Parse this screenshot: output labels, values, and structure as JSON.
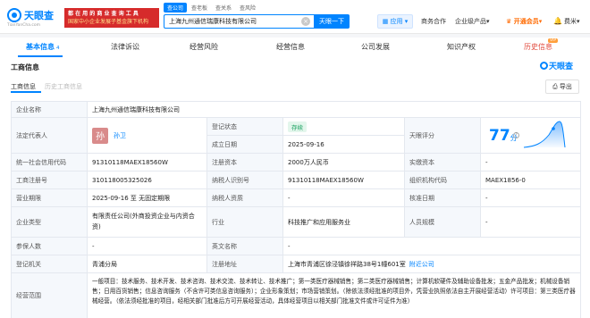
{
  "header": {
    "logo_text": "天眼查",
    "logo_sub": "TianYanCha.com",
    "promo_line1": "都 在 用 的 商 业 查 询 工 具",
    "promo_line2": "国家中小企业发展子基金旗下机构",
    "search_tabs": [
      "查公司",
      "查老板",
      "查关系",
      "查风险"
    ],
    "search_value": "上海九州通信瑞康科技有限公司",
    "search_clear": "×",
    "search_button": "天眼一下",
    "app_label": "应用",
    "nav": [
      "商务合作",
      "企业级产品"
    ],
    "vip_label": "开通会员",
    "bell_icon": "bell-icon",
    "user_label": "费米"
  },
  "tabs": {
    "items": [
      {
        "label": "基本信息",
        "count": "4"
      },
      {
        "label": "法律诉讼"
      },
      {
        "label": "经营风险"
      },
      {
        "label": "经营信息"
      },
      {
        "label": "公司发展"
      },
      {
        "label": "知识产权"
      },
      {
        "label": "历史信息"
      }
    ],
    "vip_badge": "VIP"
  },
  "section": {
    "title": "工商信息",
    "watermark": "天眼查",
    "subtabs": [
      "工商信息",
      "历史工商信息"
    ],
    "export_label": "导出"
  },
  "table": {
    "name_label": "企业名称",
    "name_value": "上海九州通信瑞康科技有限公司",
    "legal_label": "法定代表人",
    "legal_avatar": "孙",
    "legal_name": "孙卫",
    "status_label": "登记状态",
    "status_value": "存续",
    "found_label": "成立日期",
    "found_value": "2025-09-16",
    "score_label": "天眼评分",
    "score_value": "77",
    "score_unit": "分",
    "credit_label": "统一社会信用代码",
    "credit_value": "91310118MAEX18560W",
    "capital_label": "注册资本",
    "capital_value": "2000万人民币",
    "paid_label": "实缴资本",
    "paid_value": "-",
    "reg_no_label": "工商注册号",
    "reg_no_value": "310118005325026",
    "taxpayer_label": "纳税人识别号",
    "taxpayer_value": "91310118MAEX18560W",
    "org_code_label": "组织机构代码",
    "org_code_value": "MAEX1856-0",
    "period_label": "营业期限",
    "period_value": "2025-09-16 至 无固定期限",
    "taxpayer_qual_label": "纳税人资质",
    "taxpayer_qual_value": "-",
    "approve_label": "核准日期",
    "approve_value": "-",
    "type_label": "企业类型",
    "type_value": "有限责任公司(外商投资企业与内资合资)",
    "industry_label": "行业",
    "industry_value": "科技推广和应用服务业",
    "staff_label": "人员规模",
    "staff_value": "-",
    "insured_label": "参保人数",
    "insured_value": "-",
    "en_name_label": "英文名称",
    "en_name_value": "-",
    "authority_label": "登记机关",
    "authority_value": "青浦分局",
    "address_label": "注册地址",
    "address_value": "上海市青浦区徐泾镇徐祥路38号1幢601室",
    "address_link": "附近公司",
    "scope_label": "经营范围",
    "scope_value": "一般项目：技术服务、技术开发、技术咨询、技术交流、技术转让、技术推广；第一类医疗器械销售；第二类医疗器械销售；计算机软硬件及辅助设备批发；五金产品批发；机械设备销售；日用百货销售；信息咨询服务（不含许可类信息咨询服务）；企业形象策划；市场营销策划。（除依法须经批准的项目外，凭营业执照依法自主开展经营活动）许可项目：第三类医疗器械经营。（依法须经批准的项目，经相关部门批准后方可开展经营活动，具体经营项目以相关部门批准文件或许可证件为准）"
  },
  "colors": {
    "brand": "#0084ff",
    "promo_red": "#d62b2b",
    "vip_orange": "#ff6a00",
    "status_green": "#1aa260"
  }
}
